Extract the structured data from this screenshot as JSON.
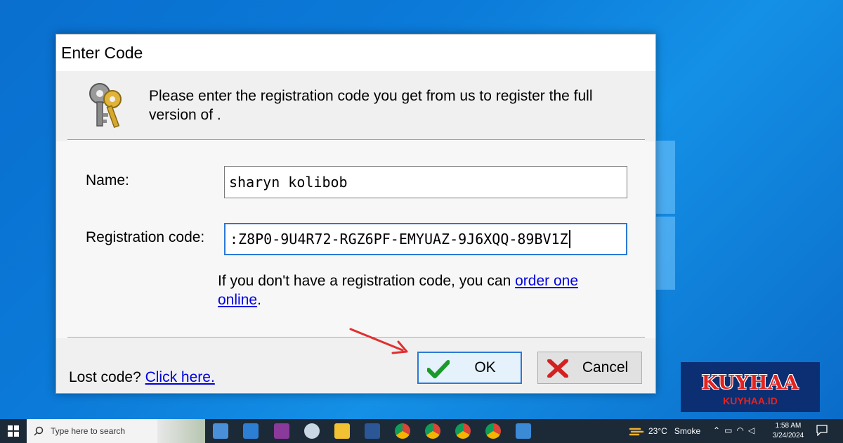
{
  "dialog": {
    "title": "Enter Code",
    "prompt": "Please enter the registration code you get from us to register the full version of .",
    "name_label": "Name:",
    "name_value": "sharyn kolibob",
    "reg_label": "Registration code:",
    "reg_value": ":Z8P0-9U4R72-RGZ6PF-EMYUAZ-9J6XQQ-89BV1Z",
    "order_text": "If you don't have a registration code, you can ",
    "order_link": "order one online",
    "order_end": ".",
    "lost_text": "Lost code? ",
    "lost_link": "Click here.",
    "ok_label": "OK",
    "cancel_label": "Cancel"
  },
  "watermark": {
    "big": "KUYHAA",
    "small": "KUYHAA.ID"
  },
  "taskbar": {
    "search_placeholder": "Type here to search",
    "weather_temp": "23°C",
    "weather_cond": "Smoke",
    "time": "1:58 AM",
    "date": "3/24/2024"
  },
  "colors": {
    "accent": "#2b79d6",
    "link": "#0000e0",
    "arrow": "#e03030",
    "desktop": "#0b7ad8"
  }
}
